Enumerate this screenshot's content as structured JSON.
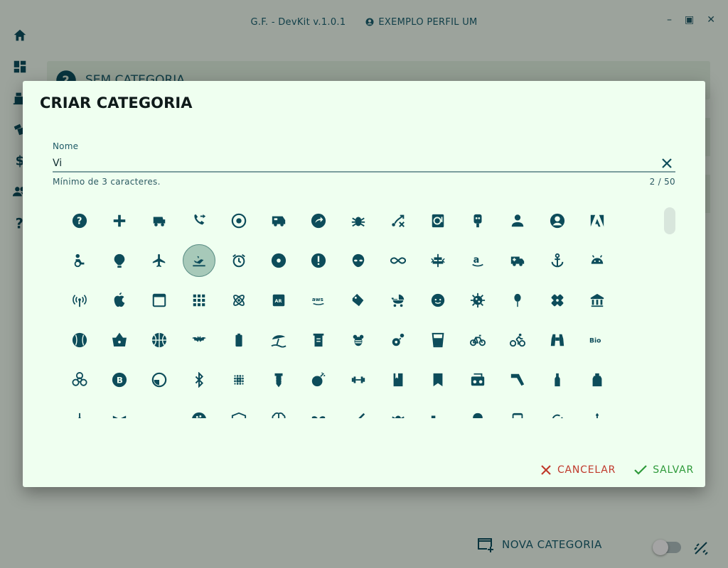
{
  "app": {
    "title": "G.F. - DevKit v.1.0.1",
    "profile": "EXEMPLO PERFIL UM"
  },
  "sidebar": {
    "items": [
      {
        "icon": "home-icon"
      },
      {
        "icon": "dashboard-icon"
      },
      {
        "icon": "register-icon"
      },
      {
        "icon": "cards-icon"
      },
      {
        "icon": "dollar-icon"
      },
      {
        "icon": "people-icon"
      },
      {
        "icon": "help-icon"
      }
    ]
  },
  "background": {
    "panel_label": "SEM CATEGORIA",
    "new_category_label": "NOVA CATEGORIA"
  },
  "dialog": {
    "title": "CRIAR CATEGORIA",
    "name_label": "Nome",
    "name_value": "Vi",
    "helper_text": "Mínimo de 3 caracteres.",
    "counter": "2 / 50",
    "cancel_label": "CANCELAR",
    "save_label": "SALVAR",
    "selected_icon": "flight-land-icon"
  },
  "colors": {
    "icon": "#0d4c5a",
    "dialog_bg": "#effff0",
    "cancel": "#c0392b",
    "save": "#2e9a3a",
    "selected_ring": "#a7c9b9"
  },
  "icons": [
    "help-icon",
    "add-icon",
    "golf-cart-icon",
    "phone-forwarded-icon",
    "settings-applications-icon",
    "rv-icon",
    "arrow-circle-icon",
    "bug-icon",
    "tactics-icon",
    "wordpress-icon",
    "webhook-icon",
    "person-icon",
    "account-circle-icon",
    "adobe-icon",
    "accessible-icon",
    "hot-air-balloon-icon",
    "airplane-icon",
    "flight-land-icon",
    "alarm-icon",
    "album-icon",
    "error-icon",
    "alien-icon",
    "all-inclusive-icon",
    "align-horizontal-icon",
    "amazon-icon",
    "ambulance-icon",
    "anchor-icon",
    "android-icon",
    "antenna-icon",
    "apple-icon",
    "application-icon",
    "apps-icon",
    "atom-icon",
    "ar-icon",
    "aws-icon",
    "tag-icon",
    "baby-carriage-icon",
    "baby-face-icon",
    "bacteria-icon",
    "balloon-icon",
    "bandage-icon",
    "bank-icon",
    "baseball-icon",
    "basket-icon",
    "basketball-icon",
    "bat-icon",
    "battery-icon",
    "beach-icon",
    "beaker-icon",
    "bee-icon",
    "flower-bee-icon",
    "cup-icon",
    "bike-icon",
    "cyclist-icon",
    "binoculars-icon",
    "bio-icon",
    "biohazard-icon",
    "bitcoin-icon",
    "circle-half-icon",
    "bluetooth-icon",
    "blur-icon",
    "screw-icon",
    "bomb-icon",
    "dumbbell-icon",
    "book-icon",
    "bookmark-icon",
    "boombox-icon",
    "boomerang-icon",
    "bottle-icon",
    "bottle-tonic-icon",
    "bottle-wine-icon",
    "bow-tie-icon",
    "blank-icon",
    "bowling-icon",
    "box-icon",
    "brain-icon",
    "bra-icon",
    "brush-icon",
    "bug-outline-icon",
    "bed-icon",
    "bulb-icon",
    "bus-icon",
    "cached-icon",
    "cake-icon"
  ]
}
